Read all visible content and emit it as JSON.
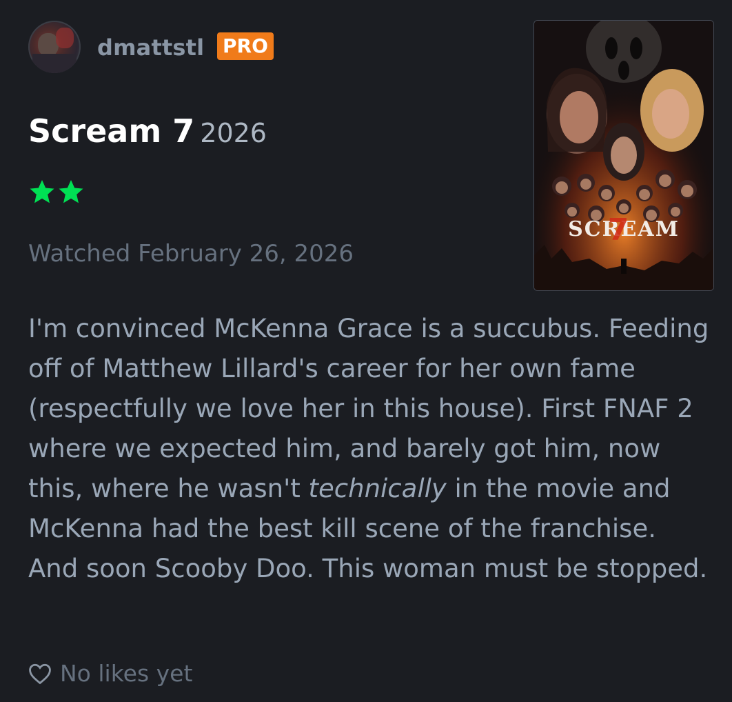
{
  "user": {
    "username": "dmattstl",
    "badge": "PRO"
  },
  "film": {
    "title": "Scream 7",
    "year": "2026",
    "rating_stars": 2,
    "watched": "Watched February 26, 2026",
    "poster_text": "SCREAM"
  },
  "review": {
    "part1": "I'm convinced McKenna Grace is a succubus. Feeding off of Matthew Lillard's career for her own fame (respectfully we love her in this house). First FNAF 2 where we expected him, and barely got him, now this, where he wasn't ",
    "emphasis": "technically",
    "part2": " in the movie and McKenna had the best kill scene of the franchise. And soon Scooby Doo. This woman must be stopped."
  },
  "likes": {
    "label": "No likes yet"
  },
  "colors": {
    "background": "#1b1d22",
    "star": "#00e054",
    "pro_badge": "#f07b1a"
  }
}
